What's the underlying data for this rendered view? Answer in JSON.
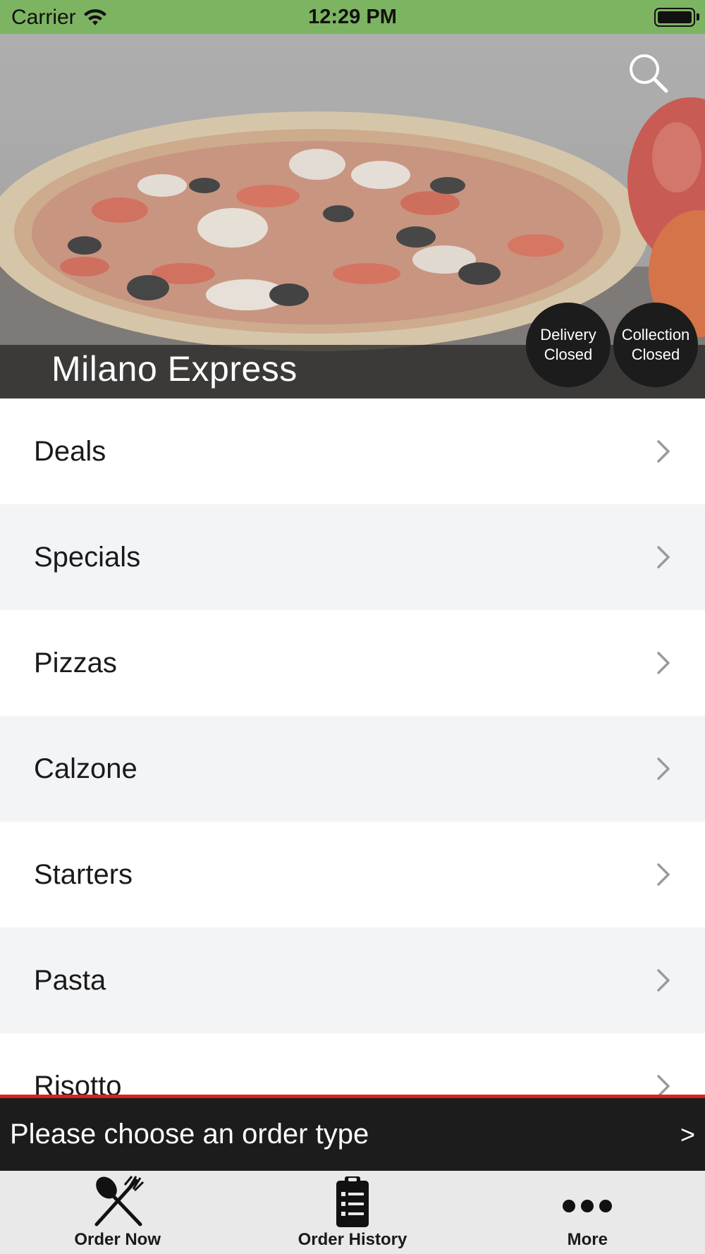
{
  "status_bar": {
    "carrier": "Carrier",
    "time": "12:29 PM",
    "background_color": "#7db462"
  },
  "hero": {
    "restaurant_name": "Milano Express",
    "search_icon": "search-icon",
    "delivery_status": {
      "line1": "Delivery",
      "line2": "Closed"
    },
    "collection_status": {
      "line1": "Collection",
      "line2": "Closed"
    }
  },
  "menu": {
    "items": [
      {
        "label": "Deals"
      },
      {
        "label": "Specials"
      },
      {
        "label": "Pizzas"
      },
      {
        "label": "Calzone"
      },
      {
        "label": "Starters"
      },
      {
        "label": "Pasta"
      },
      {
        "label": "Risotto"
      }
    ],
    "chevron_icon": "chevron-right-icon"
  },
  "order_type_bar": {
    "text": "Please choose an order type",
    "arrow": ">",
    "accent_color": "#e01e1e"
  },
  "tab_bar": {
    "tabs": [
      {
        "label": "Order Now",
        "icon": "fork-knife-icon"
      },
      {
        "label": "Order History",
        "icon": "clipboard-list-icon"
      },
      {
        "label": "More",
        "icon": "ellipsis-icon"
      }
    ]
  }
}
